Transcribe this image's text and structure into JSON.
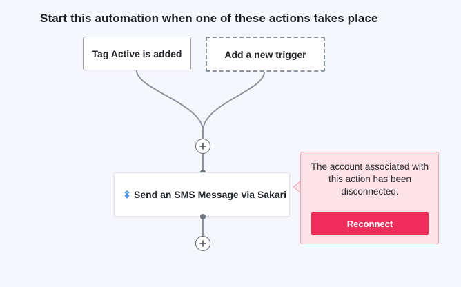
{
  "header": {
    "title": "Start this automation when one of these actions takes place"
  },
  "triggers": [
    {
      "label": "Tag Active is added"
    },
    {
      "label": "Add a new trigger"
    }
  ],
  "action": {
    "label": "Send an SMS Message via Sakari",
    "icon": "sakari-icon"
  },
  "add_step_icon": "plus-icon",
  "error_popover": {
    "message": "The account associated with this action has been disconnected.",
    "button_label": "Reconnect"
  },
  "colors": {
    "background": "#f6f7fc",
    "connector": "#8c92a0",
    "popover_bg": "#fde3e7",
    "popover_border": "#f0a2b0",
    "accent": "#ef2e5c",
    "sakari_blue": "#4a90e2"
  }
}
